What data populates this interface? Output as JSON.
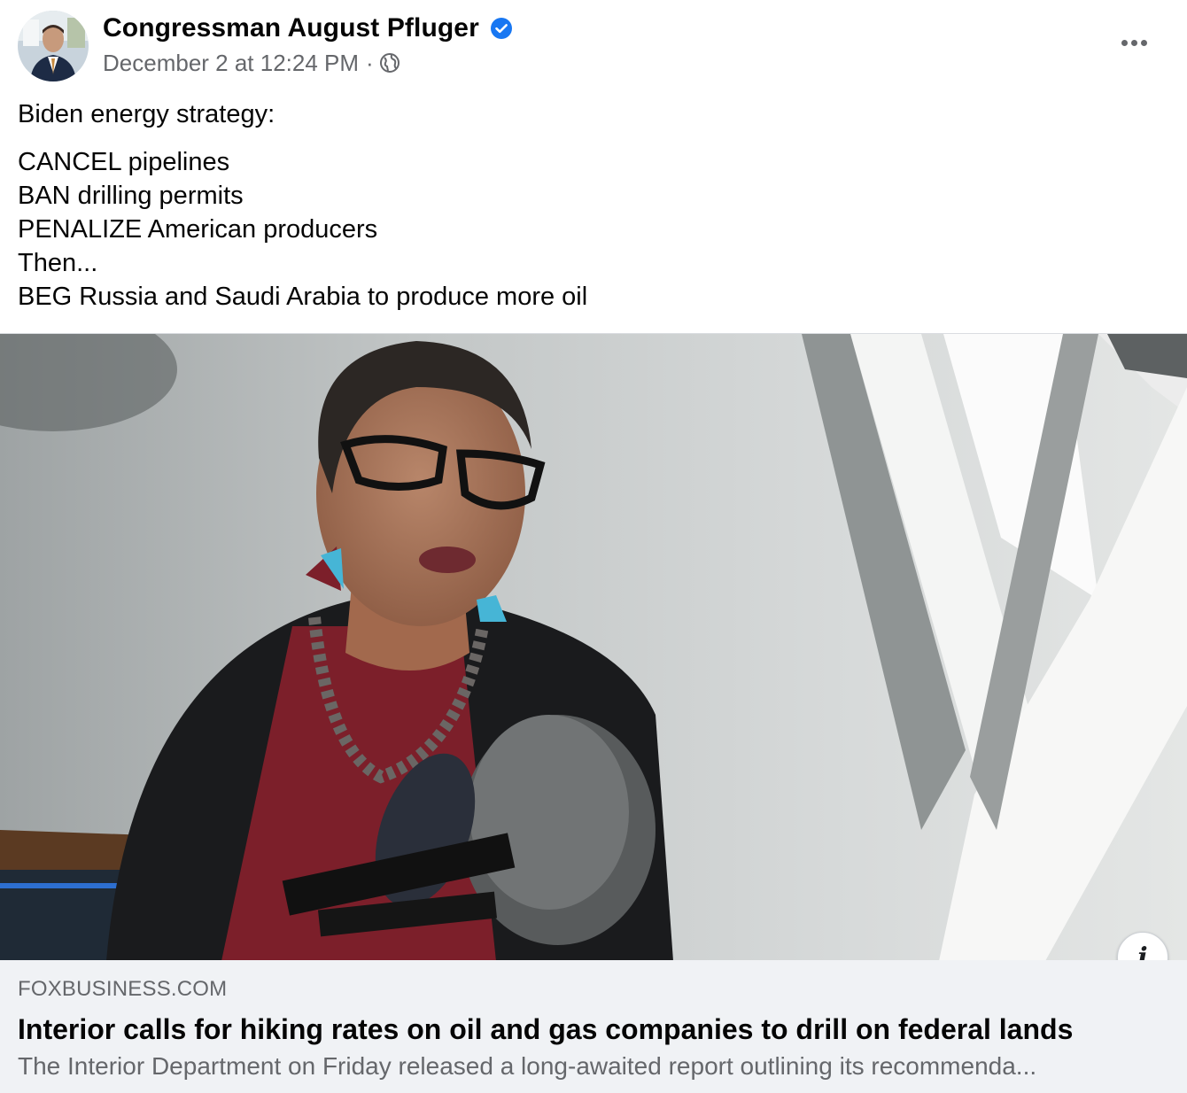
{
  "post": {
    "author": {
      "name": "Congressman August Pfluger",
      "verified_icon": "verified-badge-icon",
      "verified_color": "#1877f2"
    },
    "timestamp": "December 2 at 12:24 PM",
    "separator": "·",
    "audience_icon": "globe-icon",
    "more_icon": "more-options-icon",
    "text": {
      "intro": "Biden energy strategy:",
      "lines": [
        "CANCEL pipelines",
        "BAN drilling permits",
        "PENALIZE American producers",
        "Then...",
        "BEG Russia and Saudi Arabia to produce more oil"
      ]
    },
    "link_preview": {
      "domain": "FOXBUSINESS.COM",
      "title": "Interior calls for hiking rates on oil and gas companies to drill on federal lands",
      "description": "The Interior Department on Friday released a long-awaited report outlining its recommenda...",
      "info_icon": "info-icon",
      "info_label": "i"
    }
  },
  "colors": {
    "primary_text": "#050505",
    "secondary_text": "#65676b",
    "link_footer_bg": "#f0f2f5",
    "verified_blue": "#1877f2"
  }
}
